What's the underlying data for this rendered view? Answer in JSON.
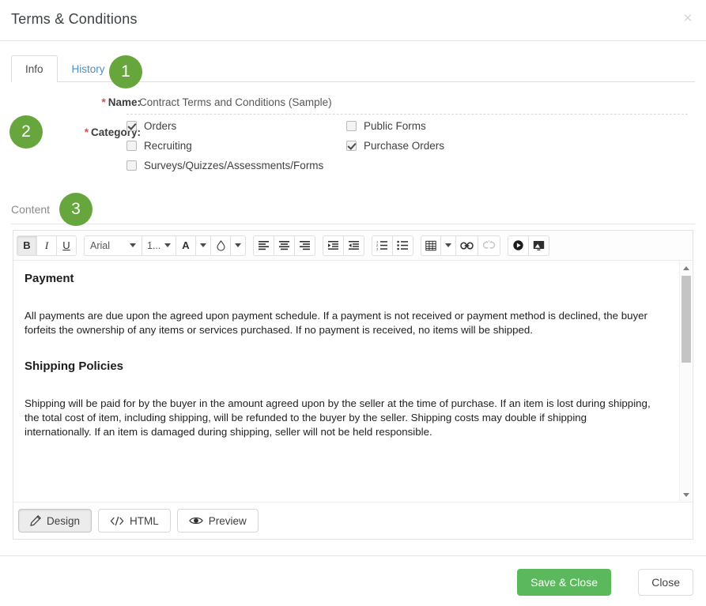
{
  "window": {
    "title": "Terms & Conditions",
    "close_label": "×"
  },
  "tabs": [
    {
      "label": "Info",
      "active": true
    },
    {
      "label": "History",
      "active": false
    }
  ],
  "form": {
    "name": {
      "required_mark": "*",
      "label": "Name:",
      "value": "Contract Terms and Conditions (Sample)"
    },
    "category": {
      "required_mark": "*",
      "label": "Category:",
      "options": [
        {
          "label": "Orders",
          "checked": true
        },
        {
          "label": "Public Forms",
          "checked": false
        },
        {
          "label": "Recruiting",
          "checked": false
        },
        {
          "label": "Purchase Orders",
          "checked": true
        },
        {
          "label": "Surveys/Quizzes/Assessments/Forms",
          "checked": false
        }
      ]
    }
  },
  "content_section": {
    "label": "Content"
  },
  "editor": {
    "toolbar": {
      "bold": "B",
      "italic": "I",
      "underline": "U",
      "font_family": "Arial",
      "font_size": "1...",
      "text_color": "A",
      "highlight_icon": "droplet-icon",
      "align_left": "align-left-icon",
      "align_center": "align-center-icon",
      "align_right": "align-right-icon",
      "indent": "indent-icon",
      "outdent": "outdent-icon",
      "ordered_list": "ordered-list-icon",
      "unordered_list": "unordered-list-icon",
      "table": "table-icon",
      "link": "link-icon",
      "unlink": "unlink-icon",
      "media": "media-play-icon",
      "image": "image-icon"
    },
    "document": {
      "heading_1": "Payment",
      "paragraph_1": "All payments are due upon the agreed upon payment schedule. If a payment is not received or payment method is declined, the buyer forfeits the ownership of any items or services purchased. If no payment is received, no items will be shipped.",
      "heading_2": "Shipping Policies",
      "paragraph_2": "Shipping will be paid for by the buyer in the amount agreed upon by the seller at the time of purchase. If an item is lost during shipping, the total cost of item, including shipping, will be refunded to the buyer by the seller. Shipping costs may double if shipping internationally. If an item is damaged during shipping, seller will not be held responsible."
    },
    "modes": [
      {
        "label": "Design",
        "icon": "pencil-icon",
        "active": true
      },
      {
        "label": "HTML",
        "icon": "code-icon",
        "active": false
      },
      {
        "label": "Preview",
        "icon": "eye-icon",
        "active": false
      }
    ]
  },
  "footer": {
    "save_label": "Save & Close",
    "close_label": "Close"
  },
  "callouts": [
    {
      "number": "1"
    },
    {
      "number": "2"
    },
    {
      "number": "3"
    }
  ],
  "colors": {
    "accent_green": "#5cb85c",
    "badge_green": "#66a63c",
    "link_blue": "#4a90c4",
    "required_red": "#c9555a"
  }
}
